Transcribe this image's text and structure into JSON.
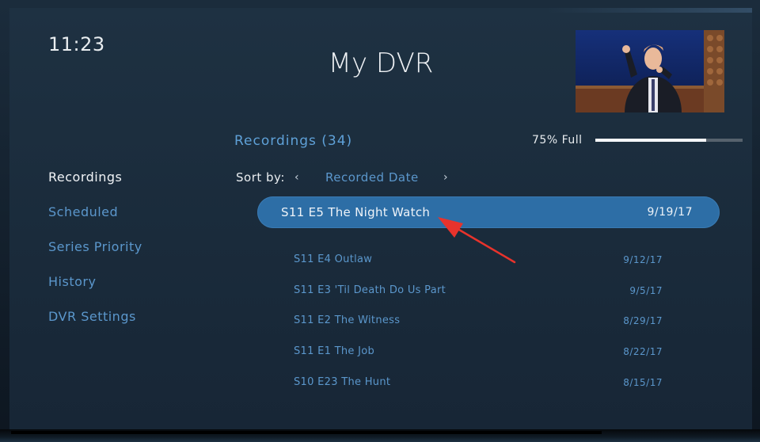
{
  "header": {
    "clock": "11:23",
    "title": "My DVR"
  },
  "recordings_header": {
    "title": "Recordings (34)",
    "storage_label": "75% Full",
    "storage_fraction": 0.75
  },
  "sidebar": {
    "items": [
      {
        "label": "Recordings",
        "active": true
      },
      {
        "label": "Scheduled",
        "active": false
      },
      {
        "label": "Series Priority",
        "active": false
      },
      {
        "label": "History",
        "active": false
      },
      {
        "label": "DVR Settings",
        "active": false
      }
    ]
  },
  "sort": {
    "label": "Sort by:",
    "prev_glyph": "‹",
    "value": "Recorded Date",
    "next_glyph": "›"
  },
  "selected": {
    "episode": "S11 E5  The Night Watch",
    "date": "9/19/17"
  },
  "recordings": [
    {
      "code": "S11 E4  Outlaw",
      "date": "9/12/17"
    },
    {
      "code": "S11 E3  'Til Death Do Us Part",
      "date": "9/5/17"
    },
    {
      "code": "S11 E2  The Witness",
      "date": "8/29/17"
    },
    {
      "code": "S11 E1  The Job",
      "date": "8/22/17"
    },
    {
      "code": "S10 E23  The Hunt",
      "date": "8/15/17"
    }
  ],
  "colors": {
    "accent": "#5b97cc",
    "highlight": "#2d6ea6",
    "background": "#1a2b3b",
    "annotation_arrow": "#e8332c"
  }
}
